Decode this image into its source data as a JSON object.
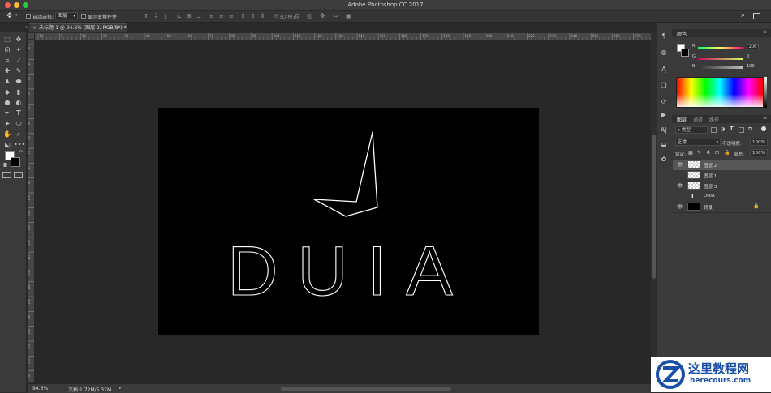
{
  "app_title": "Adobe Photoshop CC 2017",
  "window_controls": {
    "close": "#fc5f57",
    "minimize": "#fdbc2e",
    "zoom": "#28c840"
  },
  "options_bar": {
    "auto_select_label": "自动选择:",
    "auto_select_target": "图层",
    "show_transform_label": "显示变换控件",
    "mode_3d_label": "3D 模式:"
  },
  "document": {
    "tab_label": "未标题-1 @ 94.6% (图层 2, RGB/8*) *",
    "zoom": "94.6%",
    "doc_size": "文档:1.72M/5.32M",
    "text": "DUIA"
  },
  "ruler": {
    "h_ticks": [
      "10",
      "0",
      "10",
      "20",
      "30",
      "40",
      "50",
      "60",
      "70",
      "80",
      "90",
      "100",
      "110",
      "120",
      "130",
      "140",
      "150",
      "160",
      "170",
      "180",
      "190",
      "200",
      "210",
      "220",
      "230",
      "240",
      "250",
      "260",
      "270",
      "280"
    ],
    "v_ticks": [
      "0",
      "10",
      "20",
      "30",
      "40",
      "50",
      "60",
      "70",
      "80",
      "90",
      "100",
      "110",
      "120",
      "130",
      "140",
      "150",
      "160",
      "170",
      "180",
      "190",
      "200",
      "210",
      "220"
    ]
  },
  "color_panel": {
    "tab": "颜色",
    "labels": [
      "R",
      "G",
      "B"
    ],
    "values": [
      "206",
      "0",
      "100"
    ]
  },
  "layers_panel": {
    "tabs": [
      "图层",
      "通道",
      "路径"
    ],
    "filter_label": "类型",
    "blend_mode": "正常",
    "opacity_label": "不透明度:",
    "opacity_value": "100%",
    "lock_label": "锁定:",
    "fill_label": "填充:",
    "fill_value": "100%",
    "layers": [
      {
        "name": "图层 2",
        "visible": true,
        "selected": true
      },
      {
        "name": "图层 1",
        "visible": false,
        "selected": false
      },
      {
        "name": "图层 3",
        "visible": true,
        "selected": false
      },
      {
        "name": "DUIA",
        "visible": false,
        "selected": false,
        "type": "text"
      },
      {
        "name": "背景",
        "visible": true,
        "selected": false,
        "locked": true
      }
    ]
  },
  "watermark": {
    "title": "这里教程网",
    "url": "herecours.com"
  }
}
